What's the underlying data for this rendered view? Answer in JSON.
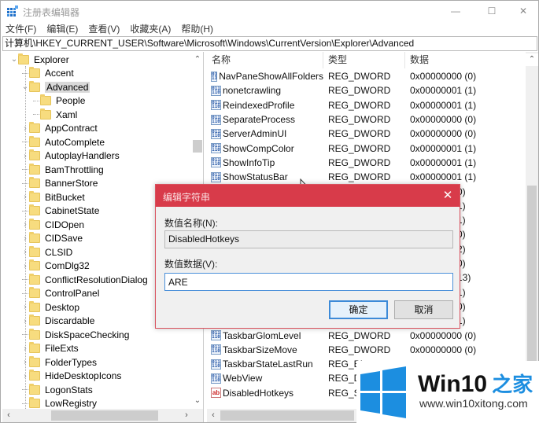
{
  "window": {
    "title": "注册表编辑器",
    "icon": "registry-editor-icon",
    "controls": {
      "minimize": "—",
      "maximize": "☐",
      "close": "✕"
    }
  },
  "menu": [
    "文件(F)",
    "编辑(E)",
    "查看(V)",
    "收藏夹(A)",
    "帮助(H)"
  ],
  "address": "计算机\\HKEY_CURRENT_USER\\Software\\Microsoft\\Windows\\CurrentVersion\\Explorer\\Advanced",
  "tree": {
    "items": [
      {
        "label": "Explorer",
        "level": 0,
        "expander": "expanded"
      },
      {
        "label": "Accent",
        "level": 1,
        "expander": "none"
      },
      {
        "label": "Advanced",
        "level": 1,
        "expander": "expanded",
        "selected": true
      },
      {
        "label": "People",
        "level": 2,
        "expander": "none"
      },
      {
        "label": "Xaml",
        "level": 2,
        "expander": "none"
      },
      {
        "label": "AppContract",
        "level": 1,
        "expander": "collapsed"
      },
      {
        "label": "AutoComplete",
        "level": 1,
        "expander": "none"
      },
      {
        "label": "AutoplayHandlers",
        "level": 1,
        "expander": "collapsed"
      },
      {
        "label": "BamThrottling",
        "level": 1,
        "expander": "none"
      },
      {
        "label": "BannerStore",
        "level": 1,
        "expander": "none"
      },
      {
        "label": "BitBucket",
        "level": 1,
        "expander": "collapsed"
      },
      {
        "label": "CabinetState",
        "level": 1,
        "expander": "none"
      },
      {
        "label": "CIDOpen",
        "level": 1,
        "expander": "collapsed"
      },
      {
        "label": "CIDSave",
        "level": 1,
        "expander": "collapsed"
      },
      {
        "label": "CLSID",
        "level": 1,
        "expander": "collapsed"
      },
      {
        "label": "ComDlg32",
        "level": 1,
        "expander": "collapsed"
      },
      {
        "label": "ConflictResolutionDialog",
        "level": 1,
        "expander": "none"
      },
      {
        "label": "ControlPanel",
        "level": 1,
        "expander": "none"
      },
      {
        "label": "Desktop",
        "level": 1,
        "expander": "collapsed"
      },
      {
        "label": "Discardable",
        "level": 1,
        "expander": "collapsed"
      },
      {
        "label": "DiskSpaceChecking",
        "level": 1,
        "expander": "none"
      },
      {
        "label": "FileExts",
        "level": 1,
        "expander": "collapsed"
      },
      {
        "label": "FolderTypes",
        "level": 1,
        "expander": "collapsed"
      },
      {
        "label": "HideDesktopIcons",
        "level": 1,
        "expander": "collapsed"
      },
      {
        "label": "LogonStats",
        "level": 1,
        "expander": "none"
      },
      {
        "label": "LowRegistry",
        "level": 1,
        "expander": "none"
      }
    ]
  },
  "list": {
    "columns": {
      "name": "名称",
      "type": "类型",
      "data": "数据"
    },
    "rows": [
      {
        "name": "NavPaneShowAllFolders",
        "type": "REG_DWORD",
        "data": "0x00000000 (0)",
        "icon": "dword"
      },
      {
        "name": "nonetcrawling",
        "type": "REG_DWORD",
        "data": "0x00000001 (1)",
        "icon": "dword"
      },
      {
        "name": "ReindexedProfile",
        "type": "REG_DWORD",
        "data": "0x00000001 (1)",
        "icon": "dword"
      },
      {
        "name": "SeparateProcess",
        "type": "REG_DWORD",
        "data": "0x00000000 (0)",
        "icon": "dword"
      },
      {
        "name": "ServerAdminUI",
        "type": "REG_DWORD",
        "data": "0x00000000 (0)",
        "icon": "dword"
      },
      {
        "name": "ShowCompColor",
        "type": "REG_DWORD",
        "data": "0x00000001 (1)",
        "icon": "dword"
      },
      {
        "name": "ShowInfoTip",
        "type": "REG_DWORD",
        "data": "0x00000001 (1)",
        "icon": "dword"
      },
      {
        "name": "ShowStatusBar",
        "type": "REG_DWORD",
        "data": "0x00000001 (1)",
        "icon": "dword"
      },
      {
        "name": "",
        "type": "",
        "data": "(0)",
        "icon": "dword"
      },
      {
        "name": "",
        "type": "",
        "data": "(1)",
        "icon": "dword"
      },
      {
        "name": "",
        "type": "",
        "data": "(1)",
        "icon": "dword"
      },
      {
        "name": "",
        "type": "",
        "data": "(0)",
        "icon": "dword"
      },
      {
        "name": "",
        "type": "",
        "data": "(2)",
        "icon": "dword"
      },
      {
        "name": "",
        "type": "",
        "data": "(0)",
        "icon": "dword"
      },
      {
        "name": "",
        "type": "",
        "data": "(13)",
        "icon": "dword"
      },
      {
        "name": "",
        "type": "",
        "data": "(1)",
        "icon": "dword"
      },
      {
        "name": "",
        "type": "",
        "data": "(0)",
        "icon": "dword"
      },
      {
        "name": "",
        "type": "",
        "data": "(1)",
        "icon": "dword"
      },
      {
        "name": "TaskbarGlomLevel",
        "type": "REG_DWORD",
        "data": "0x00000000 (0)",
        "icon": "dword"
      },
      {
        "name": "TaskbarSizeMove",
        "type": "REG_DWORD",
        "data": "0x00000000 (0)",
        "icon": "dword"
      },
      {
        "name": "TaskbarStateLastRun",
        "type": "REG_BI",
        "data": "",
        "icon": "dword"
      },
      {
        "name": "WebView",
        "type": "REG_D",
        "data": "",
        "icon": "dword"
      },
      {
        "name": "DisabledHotkeys",
        "type": "REG_SZ",
        "data": "",
        "icon": "string"
      }
    ]
  },
  "dialog": {
    "title": "编辑字符串",
    "close": "✕",
    "name_label": "数值名称(N):",
    "name_value": "DisabledHotkeys",
    "data_label": "数值数据(V):",
    "data_value": "ARE",
    "ok": "确定",
    "cancel": "取消",
    "accent": "#d83b4a"
  },
  "watermark": {
    "brand": "Win10",
    "brand_cn": "之家",
    "url": "www.win10xitong.com",
    "color": "#1c8ee0"
  },
  "scroll_arrows": {
    "up": "⌃",
    "down": "⌄",
    "left": "‹",
    "right": "›"
  }
}
